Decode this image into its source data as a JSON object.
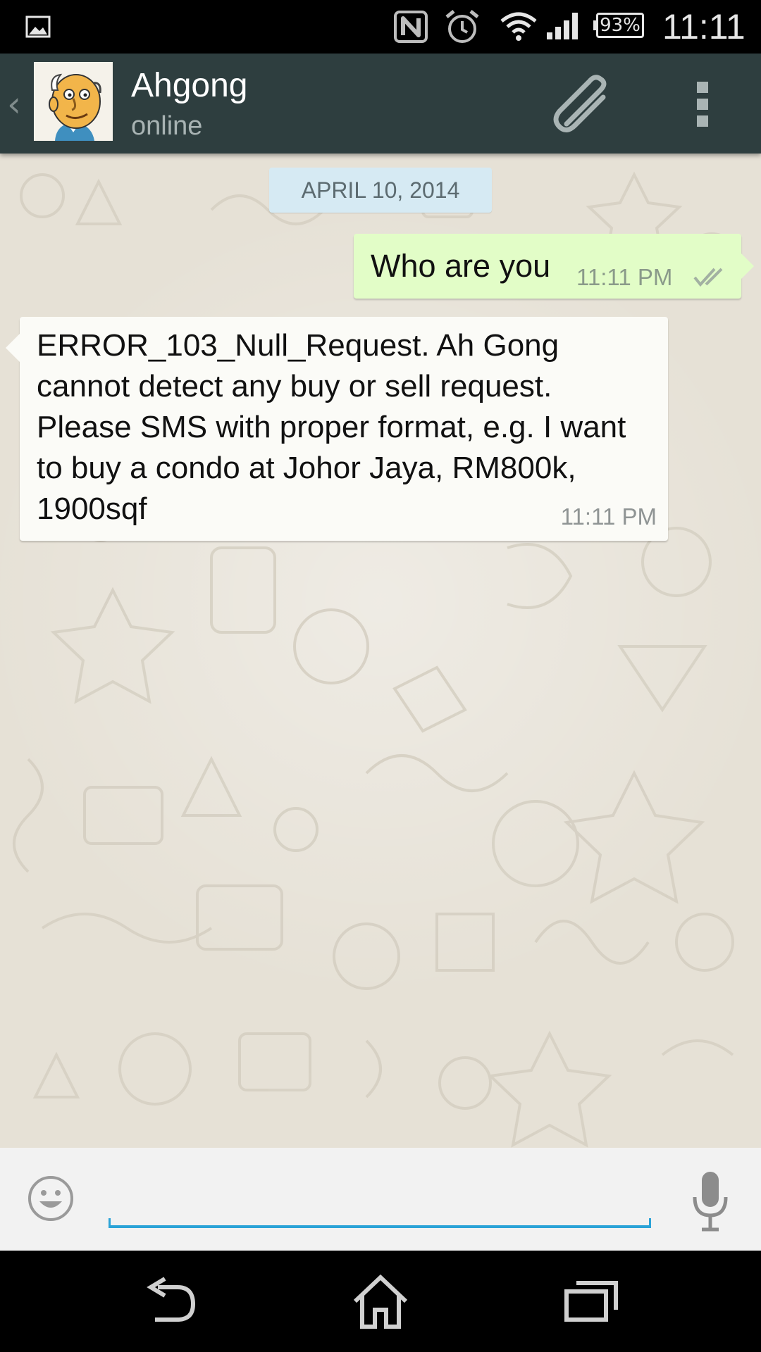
{
  "status_bar": {
    "battery_level": "93%",
    "time": "11:11",
    "icons": [
      "gallery-icon",
      "nfc-icon",
      "alarm-icon",
      "wifi-icon",
      "signal-icon",
      "battery-icon"
    ]
  },
  "header": {
    "contact_name": "Ahgong",
    "contact_status": "online",
    "back_glyph": "‹",
    "colors": {
      "background": "#2e3e3f",
      "name": "#ffffff",
      "status": "#a8b3b3"
    }
  },
  "chat": {
    "date_chip": "APRIL 10, 2014",
    "messages": [
      {
        "direction": "outgoing",
        "text": "Who are you",
        "time": "11:11 PM",
        "receipt": "double-tick-icon"
      },
      {
        "direction": "incoming",
        "text": "ERROR_103_Null_Request. Ah Gong cannot detect any buy or sell request. Please SMS with proper format, e.g. I want to buy a condo at Johor Jaya, RM800k, 1900sqf",
        "time": "11:11 PM"
      }
    ],
    "colors": {
      "outgoing_bubble": "#e2fdc7",
      "incoming_bubble": "#fbfbf7",
      "date_chip": "#d6eaf3",
      "wallpaper": "#e6e1d6"
    }
  },
  "input": {
    "value": "",
    "placeholder": "",
    "accent_color": "#2ba3d7"
  },
  "nav_bar": {
    "buttons": [
      "back-icon",
      "home-icon",
      "recents-icon"
    ]
  }
}
